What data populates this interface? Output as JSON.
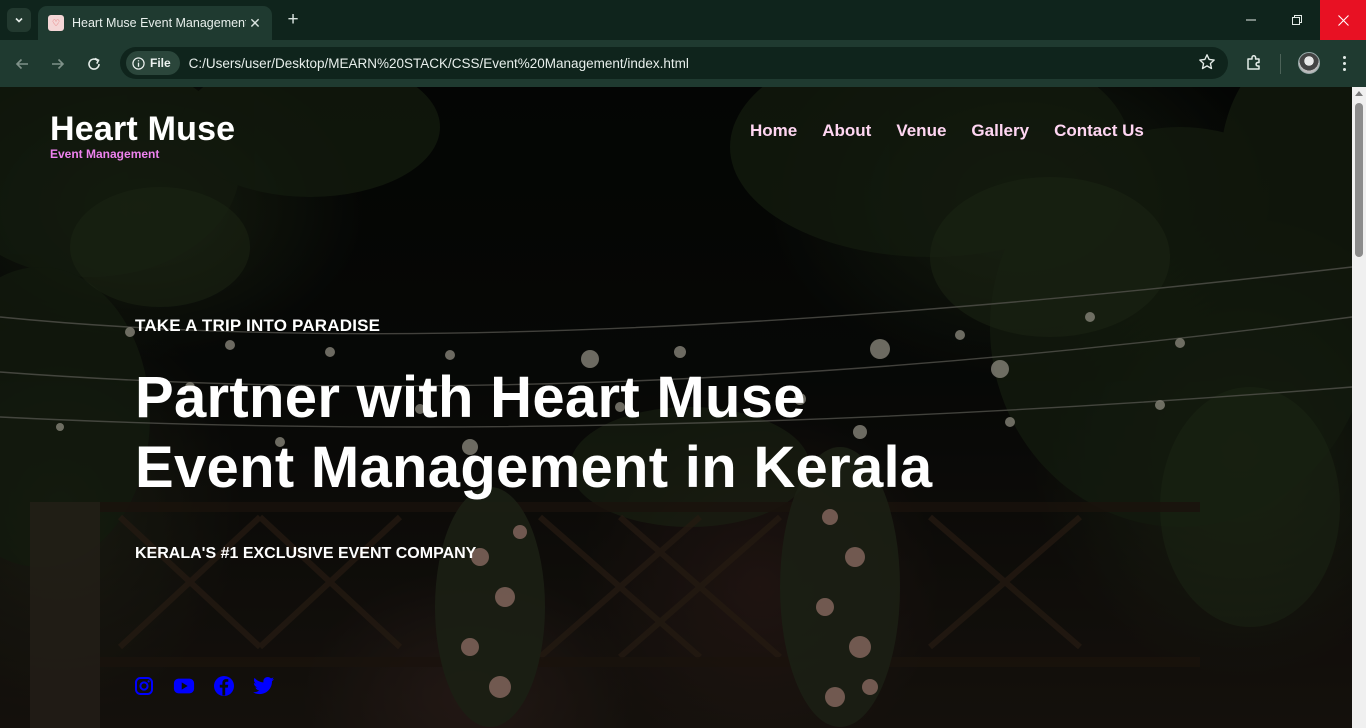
{
  "browser": {
    "tab_title": "Heart Muse Event Management",
    "site_chip": "File",
    "url": "C:/Users/user/Desktop/MEARN%20STACK/CSS/Event%20Management/index.html",
    "icons": [
      "tab-search-icon",
      "close-icon",
      "plus-icon",
      "back-arrow-icon",
      "forward-arrow-icon",
      "reload-icon",
      "info-icon",
      "star-icon",
      "extensions-icon",
      "menu-icon"
    ]
  },
  "site": {
    "logo_title": "Heart Muse",
    "logo_subtitle": "Event Management",
    "nav": [
      "Home",
      "About",
      "Venue",
      "Gallery",
      "Contact Us"
    ],
    "hero_eyebrow": "TAKE A TRIP INTO PARADISE",
    "hero_title_line1": "Partner with Heart Muse",
    "hero_title_line2": "Event Management in Kerala",
    "hero_tagline": "KERALA'S #1 EXCLUSIVE EVENT COMPANY",
    "socials": [
      "instagram-icon",
      "youtube-icon",
      "facebook-icon",
      "twitter-icon"
    ]
  },
  "colors": {
    "accent_pink": "#ee82ee",
    "nav_text": "#ffd6f2",
    "social_blue": "#0000ff",
    "chrome_dark": "#0f241c",
    "chrome_toolbar": "#1f3a30",
    "close_red": "#e81123"
  }
}
